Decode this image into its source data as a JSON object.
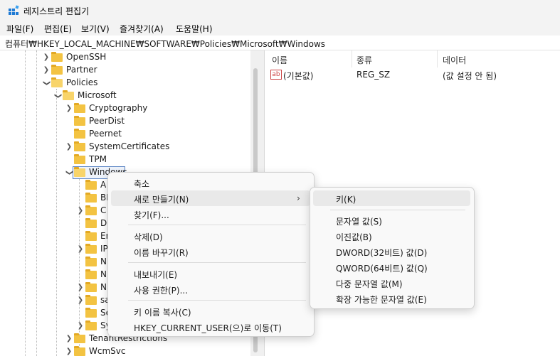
{
  "window": {
    "title": "레지스트리 편집기"
  },
  "menu": [
    "파일(F)",
    "편집(E)",
    "보기(V)",
    "즐겨찾기(A)",
    "도움말(H)"
  ],
  "address": "컴퓨터₩HKEY_LOCAL_MACHINE₩SOFTWARE₩Policies₩Microsoft₩Windows",
  "tree": [
    {
      "label": "OpenSSH"
    },
    {
      "label": "Partner"
    },
    {
      "label": "Policies"
    },
    {
      "label": "Microsoft"
    },
    {
      "label": "Cryptography"
    },
    {
      "label": "PeerDist"
    },
    {
      "label": "Peernet"
    },
    {
      "label": "SystemCertificates"
    },
    {
      "label": "TPM"
    },
    {
      "label": "Windows"
    },
    {
      "label": "A"
    },
    {
      "label": "BI"
    },
    {
      "label": "C"
    },
    {
      "label": "D"
    },
    {
      "label": "Er"
    },
    {
      "label": "IP"
    },
    {
      "label": "N"
    },
    {
      "label": "N"
    },
    {
      "label": "N"
    },
    {
      "label": "sa"
    },
    {
      "label": "Se"
    },
    {
      "label": "Sy"
    },
    {
      "label": "TenantRestrictions"
    },
    {
      "label": "WcmSvc"
    }
  ],
  "list": {
    "headers": [
      "이름",
      "종류",
      "데이터"
    ],
    "rows": [
      {
        "icon": "ab",
        "name": "(기본값)",
        "type": "REG_SZ",
        "data": "(값 설정 안 됨)"
      }
    ]
  },
  "context_menu": [
    "축소",
    "새로 만들기(N)",
    "찾기(F)...",
    "삭제(D)",
    "이름 바꾸기(R)",
    "내보내기(E)",
    "사용 권한(P)...",
    "키 이름 복사(C)",
    "HKEY_CURRENT_USER(으)로 이동(T)"
  ],
  "submenu": [
    "키(K)",
    "문자열 값(S)",
    "이진값(B)",
    "DWORD(32비트) 값(D)",
    "QWORD(64비트) 값(Q)",
    "다중 문자열 값(M)",
    "확장 가능한 문자열 값(E)"
  ],
  "colors": {
    "folder": "#f3c342",
    "selection_border": "#5b84c4",
    "menu_hover": "#e9e9e9"
  }
}
